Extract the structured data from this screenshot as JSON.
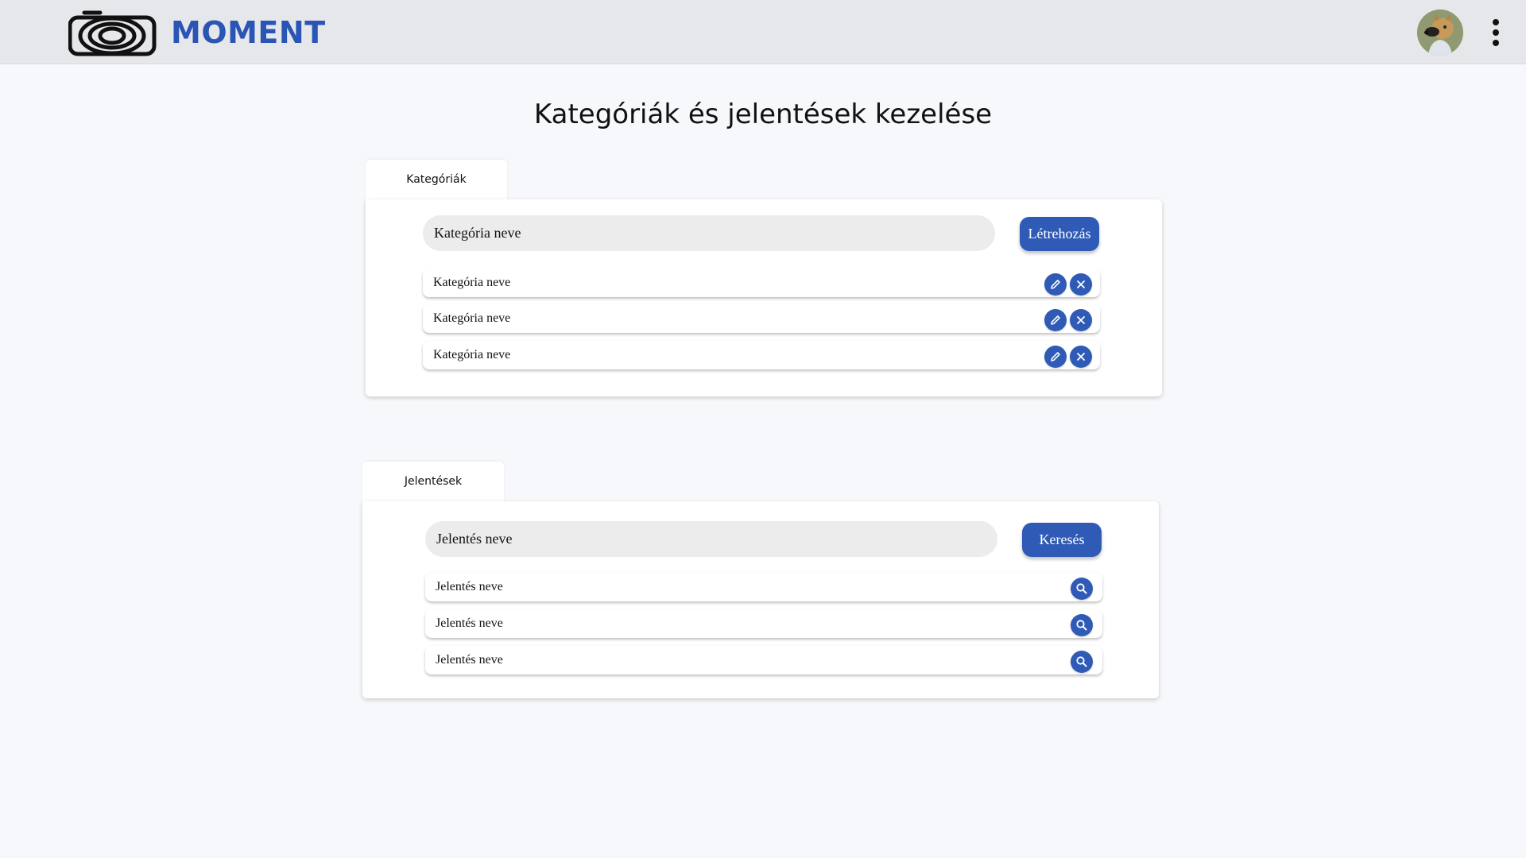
{
  "header": {
    "brand": "MOMENT",
    "logo_icon": "camera-rings-logo",
    "avatar_icon": "dog-avatar",
    "menu_icon": "vertical-dots-icon",
    "accent_color": "#2f5bb7"
  },
  "page": {
    "title": "Kategóriák és jelentések kezelése"
  },
  "categories": {
    "tab_label": "Kategóriák",
    "input_placeholder": "Kategória neve",
    "create_button": "Létrehozás",
    "items": [
      {
        "label": "Kategória neve"
      },
      {
        "label": "Kategória neve"
      },
      {
        "label": "Kategória neve"
      }
    ]
  },
  "reports": {
    "tab_label": "Jelentések",
    "input_placeholder": "Jelentés neve",
    "search_button": "Keresés",
    "items": [
      {
        "label": "Jelentés neve"
      },
      {
        "label": "Jelentés neve"
      },
      {
        "label": "Jelentés neve"
      }
    ]
  }
}
